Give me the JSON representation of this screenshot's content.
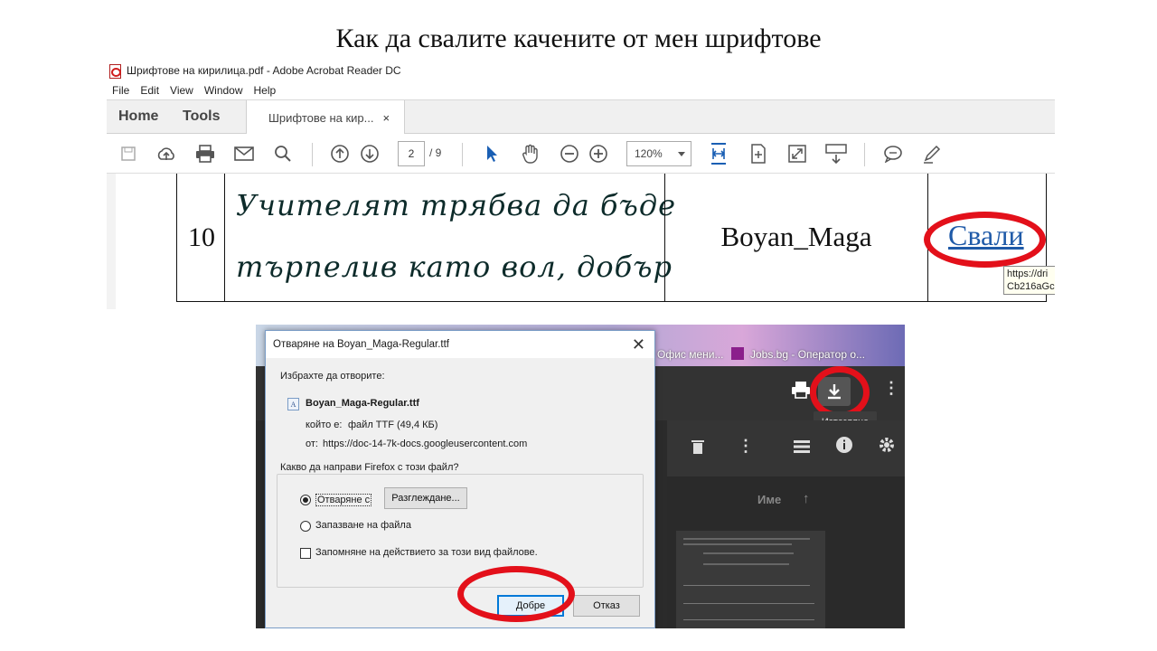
{
  "slide": {
    "title": "Как да свалите качените от мен шрифтове"
  },
  "acrobat": {
    "window_title": "Шрифтове на кирилица.pdf - Adobe Acrobat Reader DC",
    "menu": [
      "File",
      "Edit",
      "View",
      "Window",
      "Help"
    ],
    "nav_tabs": [
      "Home",
      "Tools"
    ],
    "doc_tab": "Шрифтове на кир...",
    "doc_tab_close": "×",
    "current_page": "2",
    "page_total": "/ 9",
    "zoom": "120%",
    "row": {
      "number": "10",
      "sample_line_1": "Учителят трябва да бъде",
      "sample_line_2": "търпелив като вол, добър",
      "font_name": "Boyan_Maga",
      "download_link": "Свали"
    },
    "tooltip": [
      "https://dri",
      "Cb216aGc"
    ]
  },
  "firefox": {
    "tab_labels": [
      "Офис мени...",
      "Jobs.bg - Оператор о..."
    ],
    "download_tooltip": "Изтегляне",
    "column_header": "Име",
    "dialog": {
      "title": "Отваряне на Boyan_Maga-Regular.ttf",
      "close": "✕",
      "chose_to_open": "Избрахте да отворите:",
      "file_name": "Boyan_Maga-Regular.ttf",
      "type_label": "който е:",
      "type_value": "файл TTF (49,4 КБ)",
      "from_label": "от:",
      "from_value": "https://doc-14-7k-docs.googleusercontent.com",
      "question": "Какво да направи Firefox с този файл?",
      "open_with": "Отваряне с",
      "browse": "Разглеждане...",
      "save_file": "Запазване на файла",
      "remember": "Запомняне на действието за този вид файлове.",
      "ok": "Добре",
      "cancel": "Отказ"
    }
  },
  "colors": {
    "highlight_ring": "#e3101a",
    "link": "#1f5aa8",
    "primary_button_border": "#0078d7"
  }
}
